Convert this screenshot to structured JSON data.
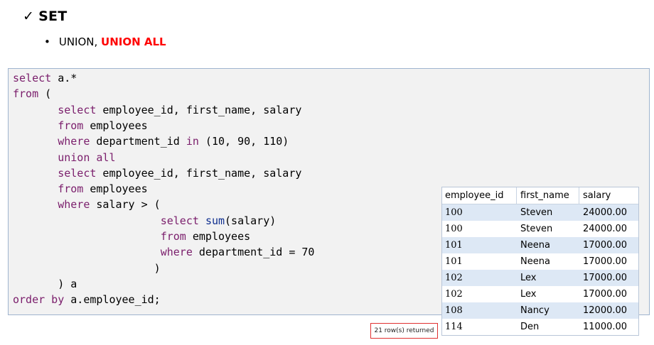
{
  "heading": {
    "check": "✓",
    "title": "SET"
  },
  "bullet": {
    "mark": "•",
    "normal": "UNION, ",
    "highlight": "UNION ALL"
  },
  "code": [
    [
      {
        "t": "select",
        "c": "kw"
      },
      {
        "t": " a.*",
        "c": ""
      }
    ],
    [
      {
        "t": "from",
        "c": "kw"
      },
      {
        "t": " (",
        "c": ""
      }
    ],
    [
      {
        "t": "       ",
        "c": ""
      },
      {
        "t": "select",
        "c": "kw"
      },
      {
        "t": " employee_id, first_name, salary",
        "c": ""
      }
    ],
    [
      {
        "t": "       ",
        "c": ""
      },
      {
        "t": "from",
        "c": "kw"
      },
      {
        "t": " employees",
        "c": ""
      }
    ],
    [
      {
        "t": "       ",
        "c": ""
      },
      {
        "t": "where",
        "c": "kw"
      },
      {
        "t": " department_id ",
        "c": ""
      },
      {
        "t": "in",
        "c": "kw"
      },
      {
        "t": " (10, 90, 110)",
        "c": ""
      }
    ],
    [
      {
        "t": "       ",
        "c": ""
      },
      {
        "t": "union all",
        "c": "kw"
      }
    ],
    [
      {
        "t": "       ",
        "c": ""
      },
      {
        "t": "select",
        "c": "kw"
      },
      {
        "t": " employee_id, first_name, salary",
        "c": ""
      }
    ],
    [
      {
        "t": "       ",
        "c": ""
      },
      {
        "t": "from",
        "c": "kw"
      },
      {
        "t": " employees",
        "c": ""
      }
    ],
    [
      {
        "t": "       ",
        "c": ""
      },
      {
        "t": "where",
        "c": "kw"
      },
      {
        "t": " salary > (",
        "c": ""
      }
    ],
    [
      {
        "t": "                       ",
        "c": ""
      },
      {
        "t": "select",
        "c": "kw"
      },
      {
        "t": " ",
        "c": ""
      },
      {
        "t": "sum",
        "c": "fn"
      },
      {
        "t": "(salary)",
        "c": ""
      }
    ],
    [
      {
        "t": "                       ",
        "c": ""
      },
      {
        "t": "from",
        "c": "kw"
      },
      {
        "t": " employees",
        "c": ""
      }
    ],
    [
      {
        "t": "                       ",
        "c": ""
      },
      {
        "t": "where",
        "c": "kw"
      },
      {
        "t": " department_id = 70",
        "c": ""
      }
    ],
    [
      {
        "t": "                      )",
        "c": ""
      }
    ],
    [
      {
        "t": "       ) a",
        "c": ""
      }
    ],
    [
      {
        "t": "order by",
        "c": "kw"
      },
      {
        "t": " a.employee_id;",
        "c": ""
      }
    ]
  ],
  "status_text": "21 row(s) returned",
  "result": {
    "columns": [
      "employee_id",
      "first_name",
      "salary"
    ],
    "rows": [
      [
        "100",
        "Steven",
        "24000.00"
      ],
      [
        "100",
        "Steven",
        "24000.00"
      ],
      [
        "101",
        "Neena",
        "17000.00"
      ],
      [
        "101",
        "Neena",
        "17000.00"
      ],
      [
        "102",
        "Lex",
        "17000.00"
      ],
      [
        "102",
        "Lex",
        "17000.00"
      ],
      [
        "108",
        "Nancy",
        "12000.00"
      ],
      [
        "114",
        "Den",
        "11000.00"
      ]
    ]
  },
  "colors": {
    "keyword": "#7a1d6b",
    "function": "#0f2f8f",
    "highlight": "#ff0000",
    "row_alt": "#dde8f5"
  }
}
